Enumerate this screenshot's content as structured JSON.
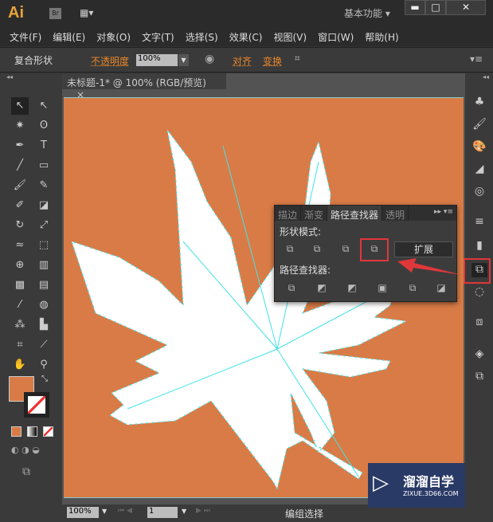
{
  "app": {
    "logo": "Ai",
    "bridge": "Br",
    "workspace": "基本功能",
    "minimize": "▬",
    "maximize": "□",
    "close": "✕"
  },
  "menu": [
    "文件(F)",
    "编辑(E)",
    "对象(O)",
    "文字(T)",
    "选择(S)",
    "效果(C)",
    "视图(V)",
    "窗口(W)",
    "帮助(H)"
  ],
  "control": {
    "selection": "复合形状",
    "opacity_label": "不透明度",
    "opacity_value": "100%",
    "align": "对齐",
    "transform": "变换"
  },
  "document": {
    "tab": "未标题-1* @ 100% (RGB/预览)",
    "close": "×",
    "artboard_color": "#d97b46"
  },
  "status": {
    "zoom": "100%",
    "page": "1",
    "tool": "编组选择"
  },
  "pathfinder": {
    "tabs": [
      "描边",
      "渐变",
      "路径查找器",
      "透明"
    ],
    "active_tab": 2,
    "shape_modes_label": "形状模式:",
    "expand": "扩展",
    "pathfinders_label": "路径查找器:",
    "highlighted": "exclude-overlap"
  },
  "watermark": {
    "name": "溜溜自学",
    "url": "ZIXUE.3D66.COM"
  },
  "colors": {
    "fill": "#d97b46",
    "highlight": "#e0373a",
    "path": "#3fe3e8"
  }
}
